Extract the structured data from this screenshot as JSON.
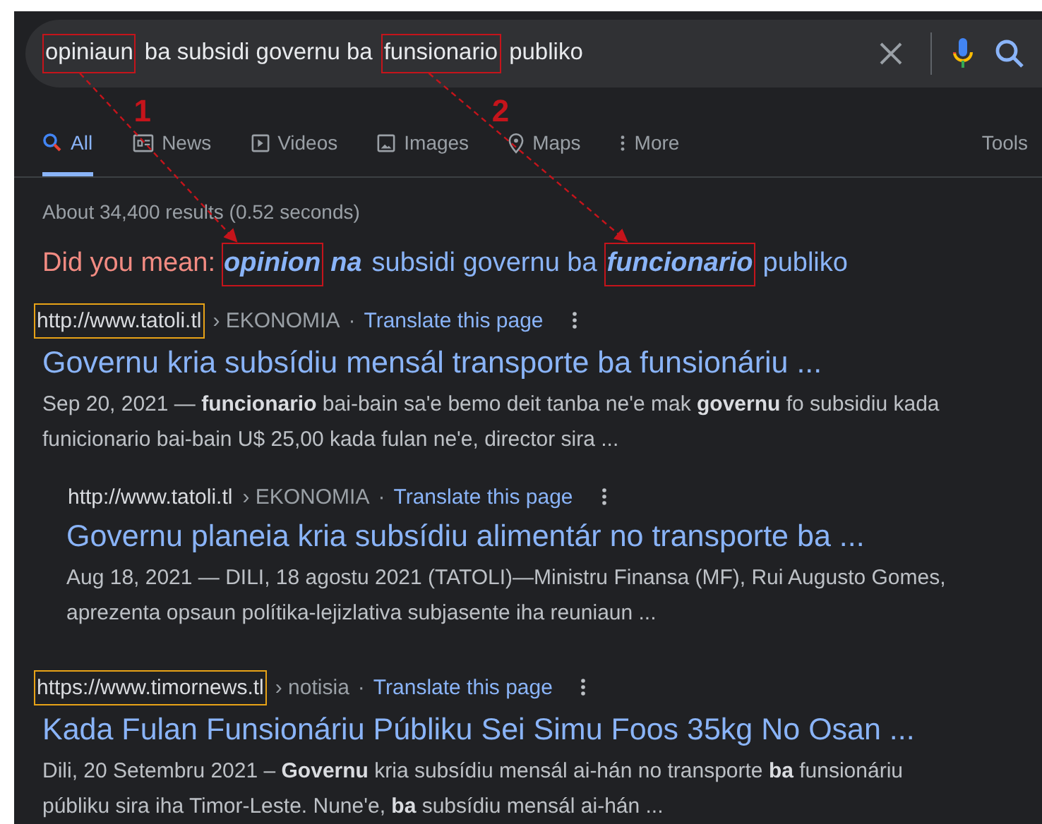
{
  "search": {
    "query": [
      {
        "text": "opiniaun",
        "marked": true
      },
      {
        "text": "ba subsidi governu ba",
        "marked": false
      },
      {
        "text": "funsionario",
        "marked": true
      },
      {
        "text": "publiko",
        "marked": false
      }
    ]
  },
  "tabs": [
    {
      "label": "All",
      "kind": "search",
      "selected": true
    },
    {
      "label": "News",
      "kind": "news",
      "selected": false
    },
    {
      "label": "Videos",
      "kind": "video",
      "selected": false
    },
    {
      "label": "Images",
      "kind": "image",
      "selected": false
    },
    {
      "label": "Maps",
      "kind": "map",
      "selected": false
    },
    {
      "label": "More",
      "kind": "more",
      "selected": false
    }
  ],
  "tools": "Tools",
  "stats": "About 34,400 results (0.52 seconds)",
  "did_you_mean": {
    "prompt": "Did you mean:",
    "suggestion": [
      {
        "text": "opinion",
        "emphasis": true,
        "marked": true
      },
      {
        "text": "na",
        "emphasis": true,
        "marked": false
      },
      {
        "text": "subsidi governu ba",
        "emphasis": false,
        "marked": false
      },
      {
        "text": "funcionario",
        "emphasis": true,
        "marked": true
      },
      {
        "text": "publiko",
        "emphasis": false,
        "marked": false
      }
    ]
  },
  "annotations": [
    {
      "label": "1"
    },
    {
      "label": "2"
    }
  ],
  "results": [
    {
      "url": "http://www.tatoli.tl",
      "breadcrumb": "› EKONOMIA",
      "separator": "·",
      "translate": "Translate this page",
      "marked": true,
      "kind": "main",
      "title": "Governu kria subsídiu mensál transporte ba funsionáriu ...",
      "snippet": [
        "Sep 20, 2021 — **funcionario** bai-bain sa'e bemo deit tanba ne'e mak **governu** fo subsidiu kada",
        "funicionario bai-bain U$ 25,00 kada fulan ne'e, director sira ..."
      ]
    },
    {
      "url": "http://www.tatoli.tl",
      "breadcrumb": "› EKONOMIA",
      "separator": "·",
      "translate": "Translate this page",
      "marked": false,
      "kind": "nested",
      "title": "Governu planeia kria subsídiu alimentár no transporte ba ...",
      "snippet": [
        "Aug 18, 2021 — DILI, 18 agostu 2021 (TATOLI)—Ministru Finansa (MF), Rui Augusto Gomes,",
        "aprezenta opsaun polítika-lejizlativa subjasente iha reuniaun ..."
      ]
    },
    {
      "url": "https://www.timornews.tl",
      "breadcrumb": "› notisia",
      "separator": "·",
      "translate": "Translate this page",
      "marked": true,
      "kind": "main",
      "title": "Kada Fulan Funsionáriu Públiku Sei Simu Foos 35kg No Osan ...",
      "snippet": [
        "Dili, 20 Setembru 2021 – **Governu** kria subsídiu mensál ai-hán no transporte **ba** funsionáriu",
        "públiku sira iha Timor-Leste. Nune'e, **ba** subsídiu mensál ai-hán ..."
      ]
    }
  ]
}
